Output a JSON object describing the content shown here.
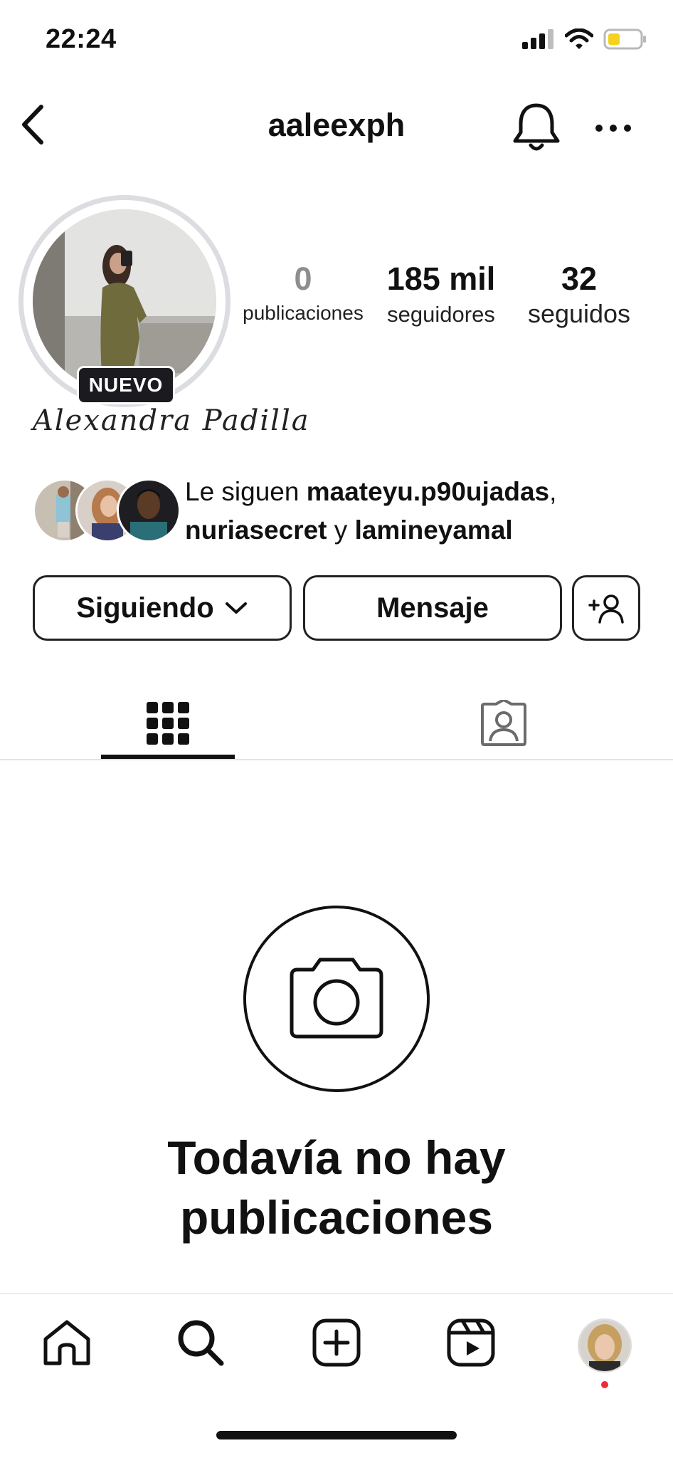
{
  "status_bar": {
    "time": "22:24"
  },
  "header": {
    "username": "aaleexph"
  },
  "profile": {
    "badge": "NUEVO",
    "full_name": "Alexandra Padilla",
    "stats": [
      {
        "value": "0",
        "label": "publicaciones"
      },
      {
        "value": "185 mil",
        "label": "seguidores"
      },
      {
        "value": "32",
        "label": "seguidos"
      }
    ],
    "followed_by": {
      "prefix": "Le siguen ",
      "user1": "maateyu.p90ujadas",
      "sep1": ",",
      "user2": "nuriasecret",
      "sep2": " y ",
      "user3": "lamineyamal"
    }
  },
  "actions": {
    "following_label": "Siguiendo",
    "message_label": "Mensaje"
  },
  "empty_state": {
    "line1": "Todavía no hay",
    "line2": "publicaciones"
  },
  "icons": {
    "back": "chevron-left-icon",
    "bell": "bell-icon",
    "more": "more-horizontal-icon",
    "grid": "grid-icon",
    "tagged": "tagged-person-icon",
    "camera": "camera-icon",
    "home": "home-icon",
    "search": "search-icon",
    "create": "plus-square-icon",
    "reels": "reels-icon"
  },
  "colors": {
    "notification_dot": "#ed2b3a",
    "badge_bg": "#1b1b1f"
  }
}
